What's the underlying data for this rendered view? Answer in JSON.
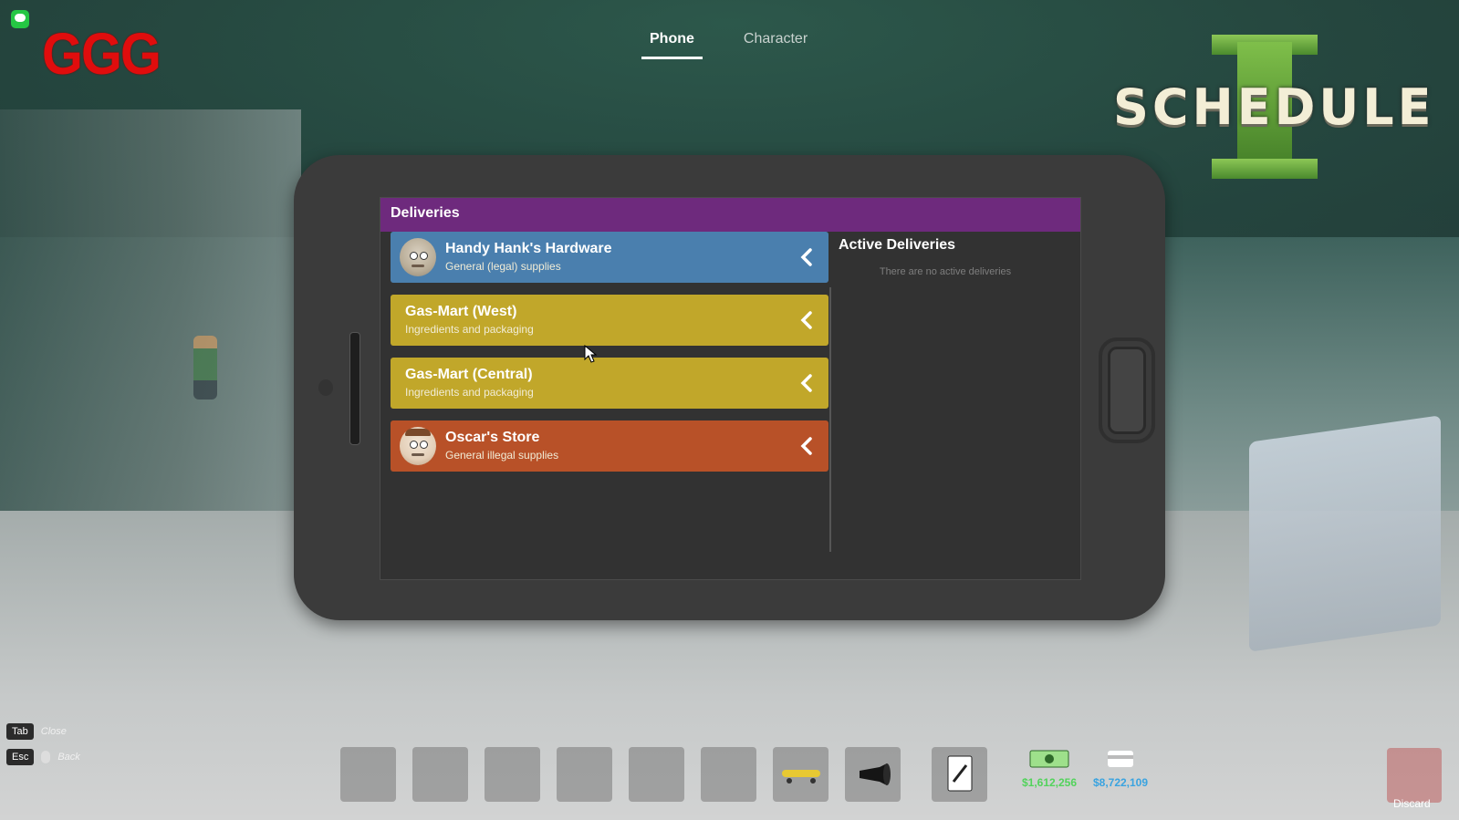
{
  "hud": {
    "logo_text": "GGG"
  },
  "tabs": [
    {
      "label": "Phone",
      "active": true
    },
    {
      "label": "Character",
      "active": false
    }
  ],
  "game_logo": {
    "text": "SCHEDULE",
    "numeral": "I"
  },
  "app": {
    "title": "Deliveries",
    "header_color": "#6e2a7d",
    "shops": [
      {
        "name": "Handy Hank's Hardware",
        "desc": "General (legal) supplies",
        "color": "#4a7fae",
        "avatar": "hank-avatar"
      },
      {
        "name": "Gas-Mart (West)",
        "desc": "Ingredients and packaging",
        "color": "#c1a72a",
        "avatar": null
      },
      {
        "name": "Gas-Mart (Central)",
        "desc": "Ingredients and packaging",
        "color": "#c1a72a",
        "avatar": null
      },
      {
        "name": "Oscar's Store",
        "desc": "General illegal supplies",
        "color": "#b85128",
        "avatar": "oscar-avatar"
      }
    ],
    "active": {
      "title": "Active Deliveries",
      "empty_text": "There are no active deliveries"
    }
  },
  "hints": [
    {
      "key": "Tab",
      "label": "Close"
    },
    {
      "key": "Esc",
      "label": "Back"
    }
  ],
  "hotbar": {
    "cash": "$1,612,256",
    "bank": "$8,722,109",
    "cash_color": "#52d35b",
    "bank_color": "#39a3e0",
    "discard_label": "Discard"
  }
}
